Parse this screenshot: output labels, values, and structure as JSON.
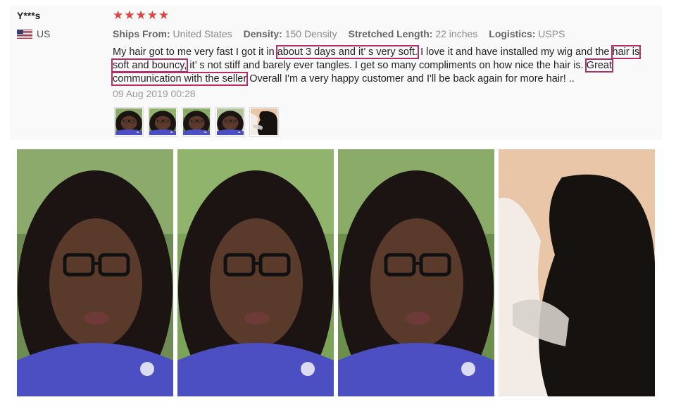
{
  "reviewer": {
    "name": "Y***s",
    "country": "US",
    "flag_icon": "us-flag-icon"
  },
  "rating": {
    "stars": 5,
    "star_color": "#e2423f"
  },
  "attributes": [
    {
      "key": "Ships From:",
      "value": "United States"
    },
    {
      "key": "Density:",
      "value": "150 Density"
    },
    {
      "key": "Stretched Length:",
      "value": "22 inches"
    },
    {
      "key": "Logistics:",
      "value": "USPS"
    }
  ],
  "review": {
    "segments": [
      {
        "text": "My hair got to me very fast I got it in ",
        "highlight": false
      },
      {
        "text": "about 3 days and it’ s very soft.",
        "highlight": true
      },
      {
        "text": " I love it and have installed my wig and the ",
        "highlight": false
      },
      {
        "text": "hair is soft and bouncy,",
        "highlight": true
      },
      {
        "text": " it’ s not stiff and barely ever tangles. I get so many compliments on how nice the hair is. ",
        "highlight": false
      },
      {
        "text": "Great communication with the seller",
        "highlight": true
      },
      {
        "text": " Overall I'm a very happy customer and I'll be back again for more hair! ..",
        "highlight": false
      }
    ],
    "highlight_color": "#b0306a",
    "date": "09 Aug 2019 00:28"
  },
  "thumbnails": [
    {
      "type": "selfie"
    },
    {
      "type": "selfie"
    },
    {
      "type": "selfie"
    },
    {
      "type": "selfie"
    },
    {
      "type": "wig-lace"
    }
  ],
  "photos": [
    {
      "type": "selfie"
    },
    {
      "type": "selfie"
    },
    {
      "type": "selfie"
    },
    {
      "type": "wig-lace"
    }
  ]
}
